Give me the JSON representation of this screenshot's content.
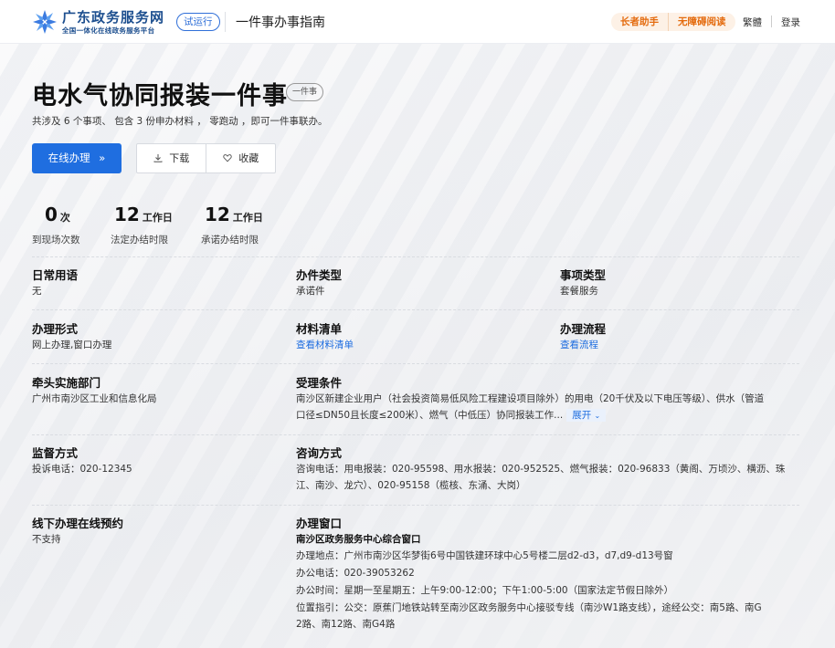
{
  "header": {
    "brand_title": "广东政务服务网",
    "brand_subtitle": "全国一体化在线政务服务平台",
    "trial_badge": "试运行",
    "guide_title": "一件事办事指南",
    "elder_assistant": "长者助手",
    "accessibility": "无障碍阅读",
    "traditional": "繁體",
    "login": "登录"
  },
  "page": {
    "title": "电水气协同报装一件事",
    "title_tag": "一件事",
    "summary": "共涉及 6 个事项、 包含 3 份申办材料 ， 零跑动 ，即可一件事联办。",
    "buttons": {
      "online": "在线办理",
      "online_icon": "»",
      "download": "下载",
      "favorite": "收藏"
    }
  },
  "stats": [
    {
      "number": "0",
      "unit": "次",
      "label": "到现场次数"
    },
    {
      "number": "12",
      "unit": "工作日",
      "label": "法定办结时限"
    },
    {
      "number": "12",
      "unit": "工作日",
      "label": "承诺办结时限"
    }
  ],
  "fields": {
    "common_name": {
      "label": "日常用语",
      "value": "无"
    },
    "handling_type": {
      "label": "办件类型",
      "value": "承诺件"
    },
    "item_type": {
      "label": "事项类型",
      "value": "套餐服务"
    },
    "handling_form": {
      "label": "办理形式",
      "value": "网上办理,窗口办理"
    },
    "materials": {
      "label": "材料清单",
      "value": "查看材料清单"
    },
    "process": {
      "label": "办理流程",
      "value": "查看流程"
    },
    "lead_dept": {
      "label": "牵头实施部门",
      "value": "广州市南沙区工业和信息化局"
    },
    "conditions": {
      "label": "受理条件",
      "line1": "南沙区新建企业用户（社会投资简易低风险工程建设项目除外）的用电（20千伏及以下电压等级）、供水（管道",
      "line2": "口径≤DN50且长度≤200米）、燃气（中低压）协同报装工作...",
      "expand": "展开"
    },
    "supervision": {
      "label": "监督方式",
      "value": "投诉电话：020-12345"
    },
    "consult": {
      "label": "咨询方式",
      "line1": "咨询电话：用电报装：020-95598、用水报装：020-952525、燃气报装：020-96833（黄阁、万顷沙、横沥、珠",
      "line2": "江、南沙、龙穴）、020-95158（榄核、东涌、大岗）"
    },
    "offline_booking": {
      "label": "线下办理在线预约",
      "value": "不支持"
    },
    "window": {
      "label": "办理窗口",
      "name": "南沙区政务服务中心综合窗口",
      "address": "办理地点：广州市南沙区华梦街6号中国铁建环球中心5号楼二层d2-d3，d7,d9-d13号窗",
      "phone": "办公电话：020-39053262",
      "hours": "办公时间：星期一至星期五：上午9:00-12:00；下午1:00-5:00（国家法定节假日除外）",
      "guide1": "位置指引：公交：原蕉门地铁站转至南沙区政务服务中心接驳专线（南沙W1路支线），途经公交：南5路、南G",
      "guide2": "2路、南12路、南G4路"
    }
  },
  "colors": {
    "primary": "#1f6ee0",
    "brand": "#1d4f8f",
    "accent_orange": "#e46b0e"
  }
}
